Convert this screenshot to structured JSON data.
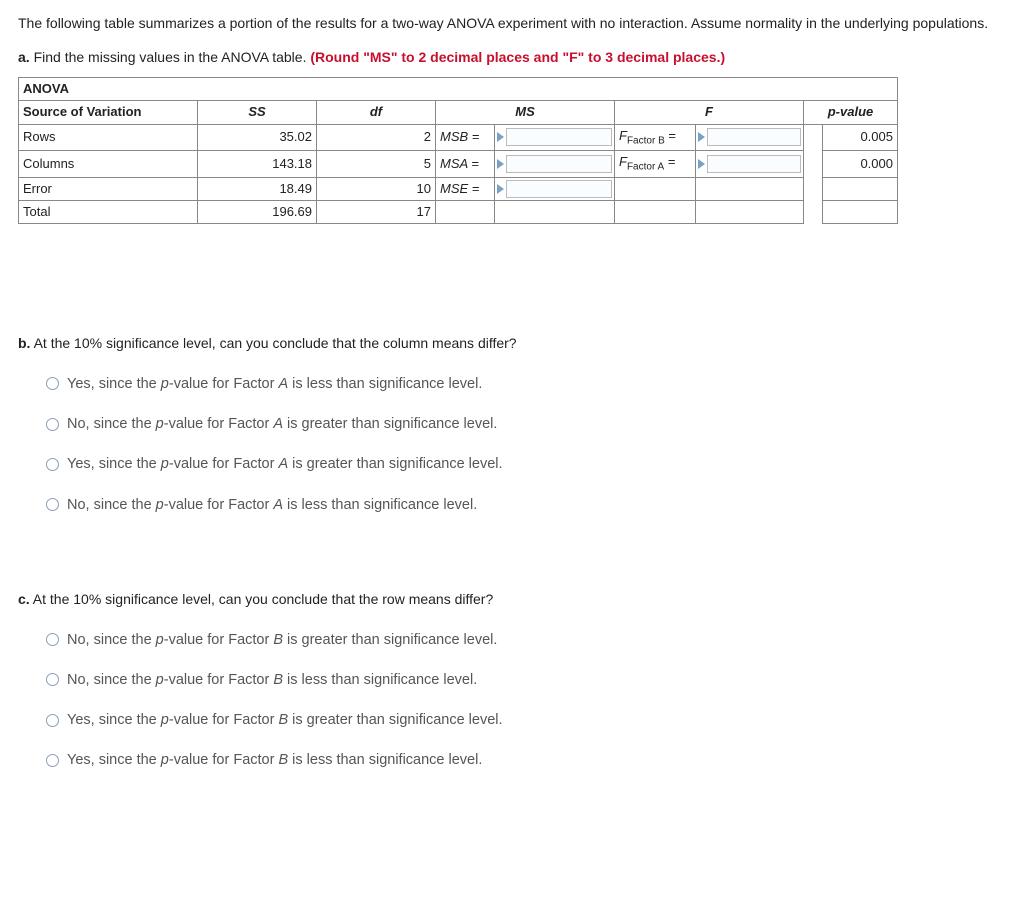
{
  "intro": "The following table summarizes a portion of the results for a two-way ANOVA experiment with no interaction. Assume normality in the underlying populations.",
  "part_a": {
    "label": "a.",
    "text": " Find the missing values in the ANOVA table. ",
    "instr": "(Round  \"MS\" to 2 decimal places and \"F\" to 3 decimal places.)"
  },
  "chart_data": {
    "type": "table",
    "title": "ANOVA",
    "columns": [
      "Source of Variation",
      "SS",
      "df",
      "MS",
      "F",
      "p-value"
    ],
    "rows": [
      {
        "sov": "Rows",
        "ss": "35.02",
        "df": "2",
        "ms_label": "MSB =",
        "f_label": "FFactor B =",
        "pvalue": "0.005"
      },
      {
        "sov": "Columns",
        "ss": "143.18",
        "df": "5",
        "ms_label": "MSA =",
        "f_label": "FFactor A =",
        "pvalue": "0.000"
      },
      {
        "sov": "Error",
        "ss": "18.49",
        "df": "10",
        "ms_label": "MSE =",
        "f_label": "",
        "pvalue": ""
      },
      {
        "sov": "Total",
        "ss": "196.69",
        "df": "17",
        "ms_label": "",
        "f_label": "",
        "pvalue": ""
      }
    ]
  },
  "part_b": {
    "label": "b.",
    "text": " At the 10% significance level, can you conclude that the column means differ?",
    "options": [
      "Yes, since the p-value for Factor A is less than significance level.",
      "No, since the p-value for Factor A is greater than significance level.",
      "Yes, since the p-value for Factor A is greater than significance level.",
      "No, since the p-value for Factor A is less than significance level."
    ]
  },
  "part_c": {
    "label": "c.",
    "text": " At the 10% significance level, can you conclude that the row means differ?",
    "options": [
      "No, since the p-value for Factor B is greater than significance level.",
      "No, since the p-value for Factor B is less than significance level.",
      "Yes, since the p-value for Factor B is greater than significance level.",
      "Yes, since the p-value for Factor B is less than significance level."
    ]
  }
}
